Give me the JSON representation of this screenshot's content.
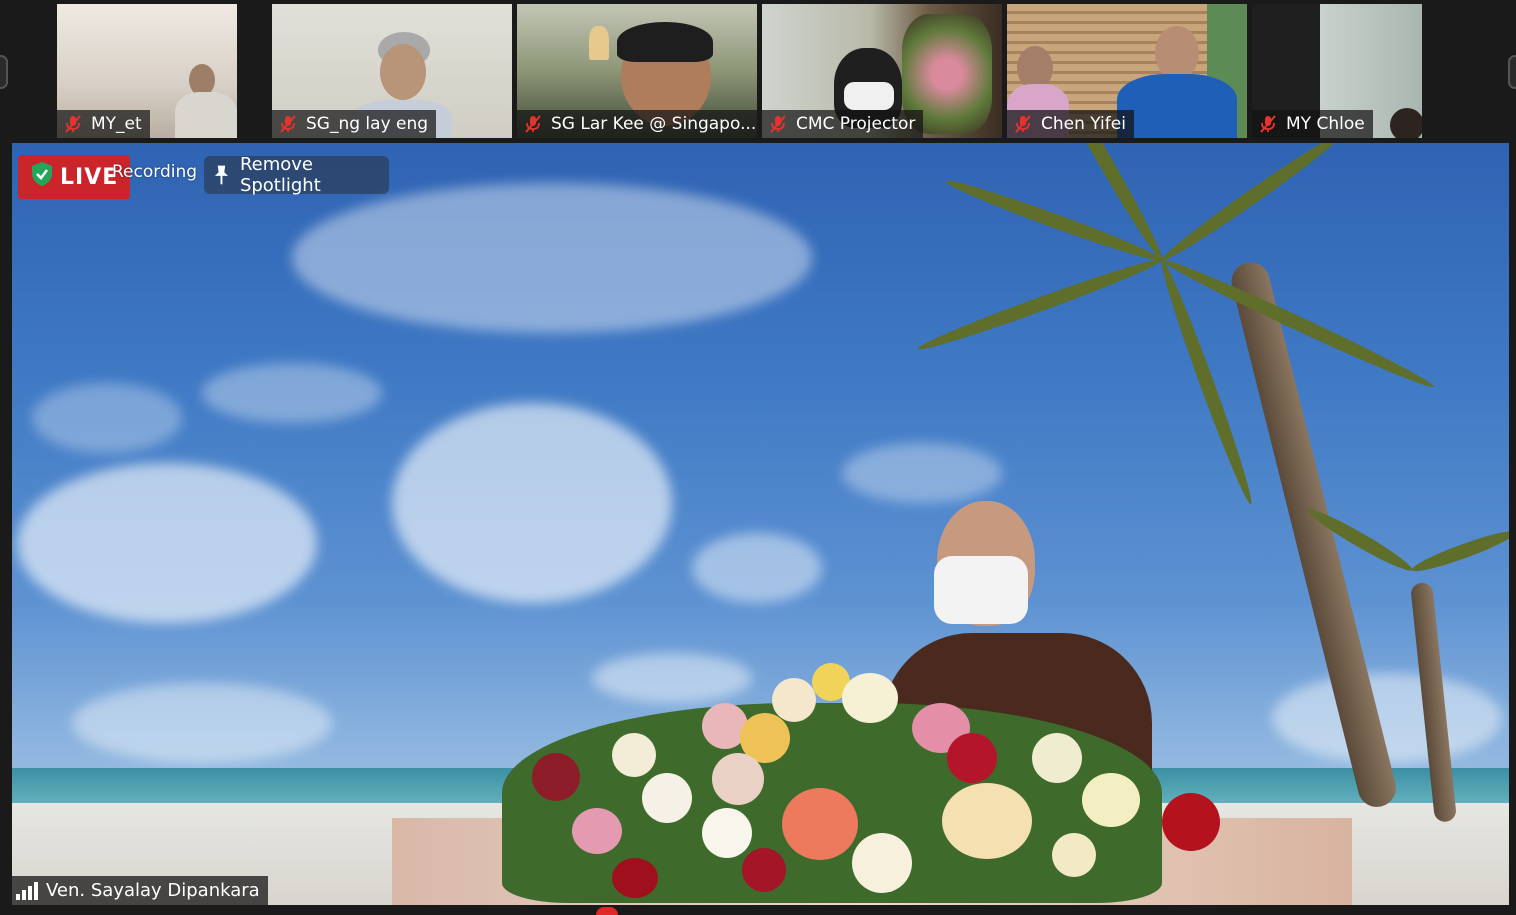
{
  "participants": [
    {
      "name": "MY_et",
      "muted": true
    },
    {
      "name": "SG_ng lay eng",
      "muted": true
    },
    {
      "name": "SG Lar Kee @ Singapo...",
      "muted": true
    },
    {
      "name": "CMC Projector",
      "muted": true
    },
    {
      "name": "Chen Yifei",
      "muted": true
    },
    {
      "name": "MY Chloe",
      "muted": true
    }
  ],
  "overlay": {
    "live_badge": "LIVE",
    "recording_label": "Recording",
    "remove_spotlight_label": "Remove Spotlight"
  },
  "spotlight": {
    "speaker_name": "Ven. Sayalay Dipankara"
  },
  "colors": {
    "muted_icon": "#e8322d",
    "live_red": "#c9252b",
    "secure_green": "#23a55a"
  },
  "icons": [
    "mic-muted-icon",
    "shield-check-icon",
    "pin-icon",
    "signal-strength-icon"
  ]
}
